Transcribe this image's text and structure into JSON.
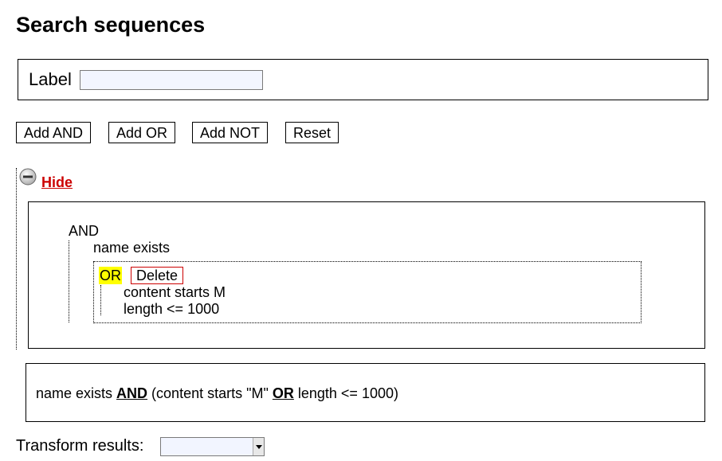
{
  "page": {
    "title": "Search sequences"
  },
  "label_field": {
    "label": "Label",
    "value": ""
  },
  "buttons": {
    "add_and": "Add AND",
    "add_or": "Add OR",
    "add_not": "Add NOT",
    "reset": "Reset"
  },
  "tree": {
    "toggle_label": "Hide",
    "root": {
      "op": "AND",
      "conditions": [
        "name exists"
      ],
      "group": {
        "op": "OR",
        "delete_label": "Delete",
        "conditions": [
          "content starts M",
          "length <= 1000"
        ]
      }
    }
  },
  "expression": {
    "part1": "name exists ",
    "op1": "AND",
    "part2": " (content starts \"M\" ",
    "op2": "OR",
    "part3": " length <= 1000)"
  },
  "transform": {
    "label": "Transform results:",
    "selected": ""
  },
  "colors": {
    "accent_red": "#cc0000",
    "highlight_yellow": "#ffff00",
    "input_bg": "#f2f5ff"
  }
}
